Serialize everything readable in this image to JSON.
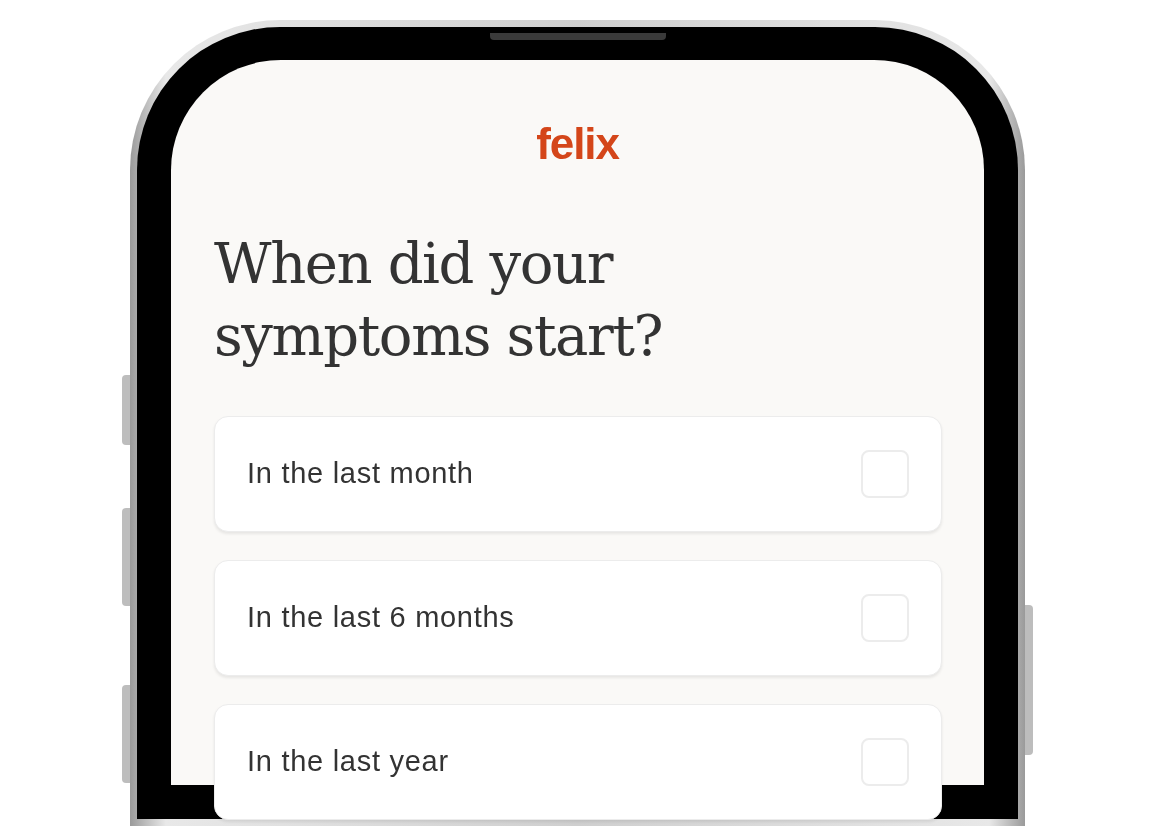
{
  "app": {
    "logo": "felix"
  },
  "question": "When did your symptoms start?",
  "options": [
    {
      "label": "In the last month",
      "checked": false
    },
    {
      "label": "In the last 6 months",
      "checked": false
    },
    {
      "label": "In the last year",
      "checked": false
    }
  ]
}
